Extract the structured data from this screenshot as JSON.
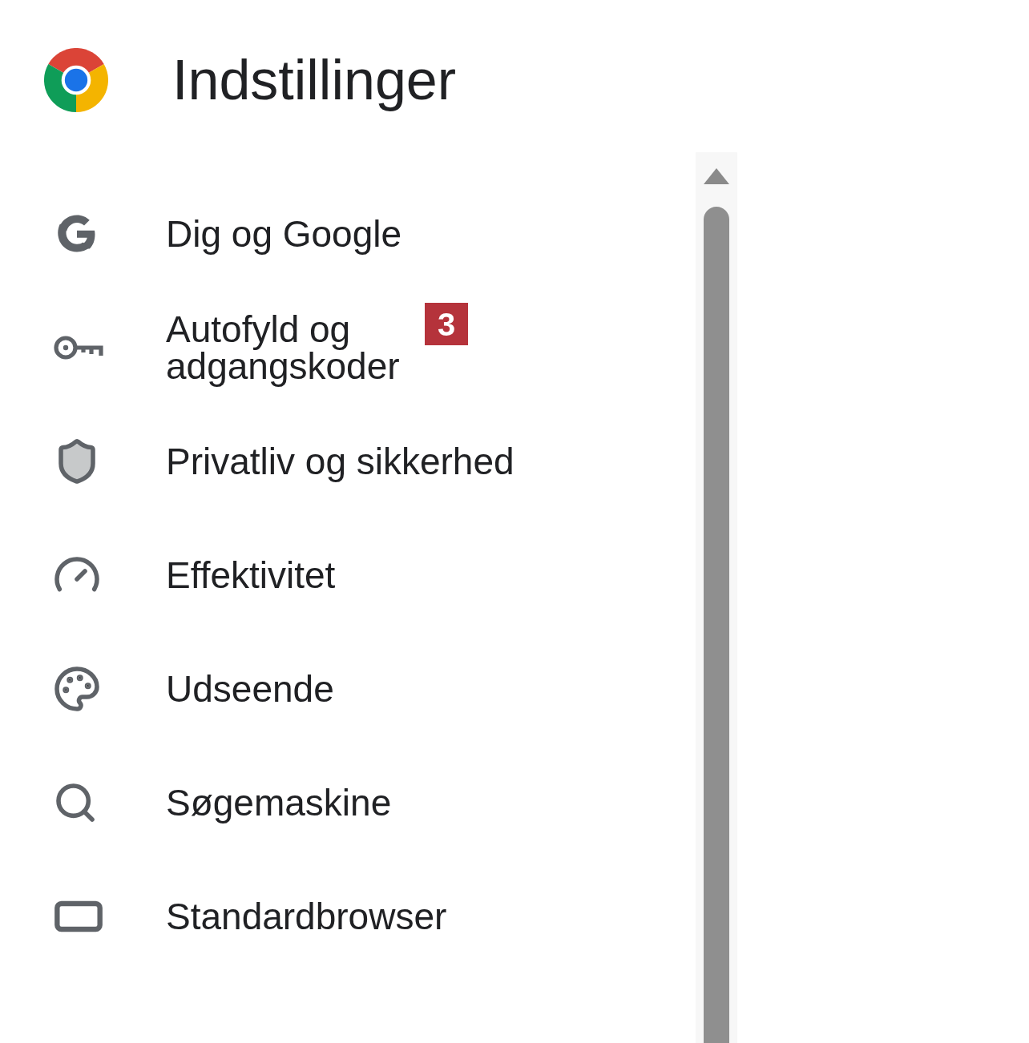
{
  "header": {
    "title": "Indstillinger"
  },
  "menu": [
    {
      "label": "Dig og Google"
    },
    {
      "label": "Autofyld og\nadgangskoder",
      "badge": "3"
    },
    {
      "label": "Privatliv og sikkerhed"
    },
    {
      "label": "Effektivitet"
    },
    {
      "label": "Udseende"
    },
    {
      "label": "Søgemaskine"
    },
    {
      "label": "Standardbrowser"
    }
  ]
}
